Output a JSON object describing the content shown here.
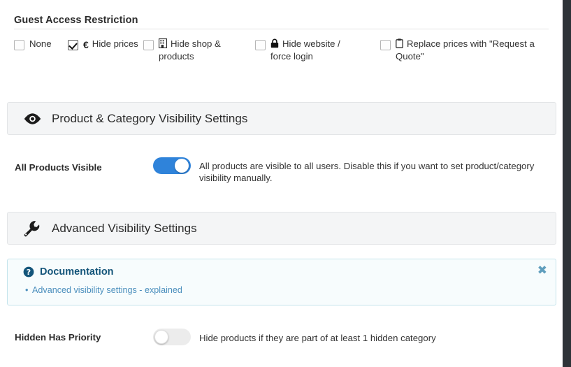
{
  "guest_access": {
    "title": "Guest Access Restriction",
    "options": [
      {
        "label": "None",
        "icon": "none",
        "checked": false
      },
      {
        "label": "Hide prices",
        "icon": "euro-icon",
        "checked": true
      },
      {
        "label": "Hide shop & products",
        "icon": "shop-building-icon",
        "checked": false
      },
      {
        "label": "Hide website / force login",
        "icon": "lock-icon",
        "checked": false
      },
      {
        "label": "Replace prices with \"Request a Quote\"",
        "icon": "clipboard-icon",
        "checked": false
      }
    ]
  },
  "product_visibility_panel": {
    "icon": "eye-icon",
    "title": "Product & Category Visibility Settings",
    "setting": {
      "label": "All Products Visible",
      "toggle_state": "on",
      "description": "All products are visible to all users. Disable this if you want to set product/category visibility manually."
    }
  },
  "advanced_visibility_panel": {
    "icon": "wrench-icon",
    "title": "Advanced Visibility Settings",
    "setting": {
      "label": "Hidden Has Priority",
      "toggle_state": "off",
      "description": "Hide products if they are part of at least 1 hidden category"
    }
  },
  "documentation": {
    "icon": "question-circle-icon",
    "title": "Documentation",
    "bullet": "•",
    "link_text": "Advanced visibility settings - explained",
    "close_label": "✖"
  },
  "colors": {
    "toggle_on": "#2f83da",
    "toggle_off": "#ececec",
    "panel_header_bg": "#f4f5f6",
    "doc_border": "#c5e4ec",
    "doc_title": "#14557a",
    "doc_link": "#4b8fbd",
    "window_edge": "#2e3338"
  }
}
